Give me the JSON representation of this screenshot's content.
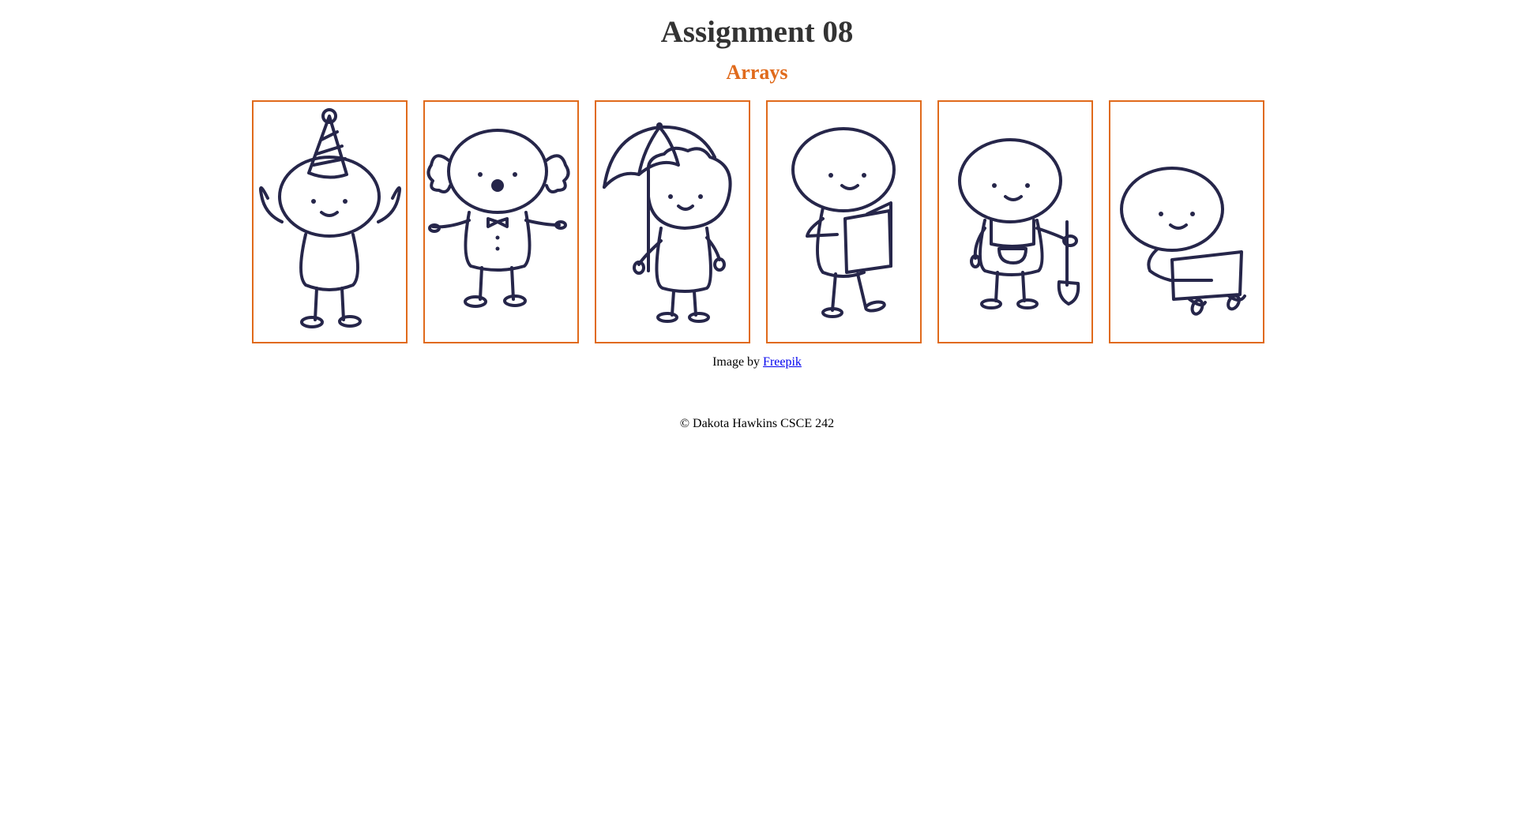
{
  "header": {
    "title": "Assignment 08",
    "subtitle": "Arrays"
  },
  "colors": {
    "accent": "#e06a1b",
    "title_text": "#333333",
    "figure_ink": "#26264a",
    "link": "#0000ee"
  },
  "gallery": {
    "images": [
      {
        "icon": "party-hat-stick-figure-icon"
      },
      {
        "icon": "clown-stick-figure-icon"
      },
      {
        "icon": "umbrella-stick-figure-icon"
      },
      {
        "icon": "reading-book-stick-figure-icon"
      },
      {
        "icon": "gardener-shovel-stick-figure-icon"
      },
      {
        "icon": "laptop-stick-figure-icon"
      }
    ]
  },
  "credit": {
    "prefix": "Image by ",
    "link_label": "Freepik"
  },
  "footer": {
    "text": "© Dakota Hawkins CSCE 242"
  }
}
